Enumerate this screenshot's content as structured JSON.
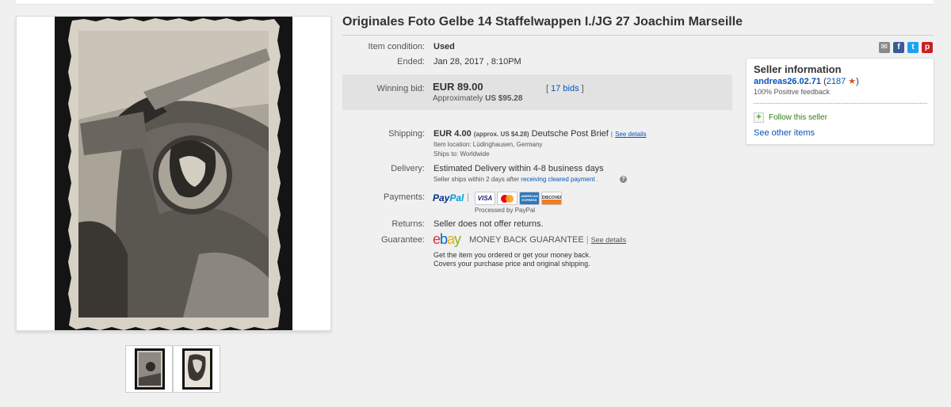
{
  "listing": {
    "title": "Originales Foto Gelbe 14 Staffelwappen I./JG 27 Joachim Marseille"
  },
  "details": {
    "condition_label": "Item condition:",
    "condition_value": "Used",
    "ended_label": "Ended:",
    "ended_value": "Jan 28, 2017 , 8:10PM",
    "winning_label": "Winning bid:",
    "price": "EUR 89.00",
    "approx_prefix": "Approximately",
    "approx_value": "US $95.28",
    "bids_open": "[",
    "bids_text": "17 bids",
    "bids_close": "]",
    "shipping_label": "Shipping:",
    "shipping_value": "EUR 4.00",
    "shipping_approx": "(approx. US $4.28)",
    "shipping_service": "Deutsche Post Brief",
    "shipping_sep": "|",
    "see_details": "See details",
    "item_location": "Item location:  Lüdinghausen, Germany",
    "ships_to": "Ships to:  Worldwide",
    "delivery_label": "Delivery:",
    "delivery_value": "Estimated Delivery within 4-8 business days",
    "delivery_note_prefix": "Seller ships within 2 days after",
    "delivery_note_link": "receiving cleared payment",
    "delivery_note_suffix": ".",
    "payments_label": "Payments:",
    "paypal_part1": "Pay",
    "paypal_part2": "Pal",
    "payments_sep": "|",
    "processed_by": "Processed by PayPal",
    "returns_label": "Returns:",
    "returns_value": "Seller does not offer returns.",
    "guarantee_label": "Guarantee:",
    "mbg_text": "MONEY BACK GUARANTEE",
    "mbg_sep": "|",
    "mbg_see_details": "See details",
    "guarantee_line1": "Get the item you ordered or get your money back.",
    "guarantee_line2": "Covers your purchase price and original shipping."
  },
  "cards": {
    "visa": "VISA",
    "amex": "AMERICAN EXPRESS",
    "discover": "DISCOVER"
  },
  "ebay_logo": [
    "e",
    "b",
    "a",
    "y"
  ],
  "seller": {
    "heading": "Seller information",
    "name": "andreas26.02.71",
    "score_open": "(",
    "score": "2187",
    "score_close": ")",
    "star": "★",
    "positive": "100% Positive feedback",
    "follow_icon": "+",
    "follow": "Follow this seller",
    "other_items": "See other items"
  },
  "share_icons": {
    "mail": "✉",
    "facebook": "f",
    "twitter": "t",
    "pinterest": "p"
  },
  "help_icon": "?",
  "colors": {
    "link": "#0654ba",
    "bid_box": "#e2e2e2",
    "follow_green": "#2f7d0f"
  }
}
